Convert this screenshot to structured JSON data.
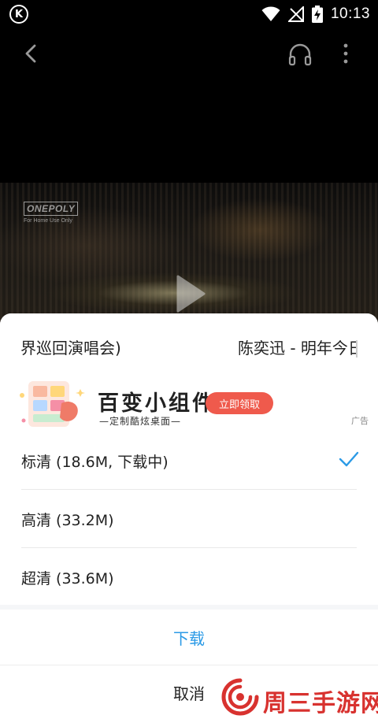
{
  "status_bar": {
    "app_icon_letter": "K",
    "time": "10:13",
    "icons": [
      "wifi-icon",
      "no-signal-icon",
      "battery-charging-icon"
    ]
  },
  "player": {
    "watermark_brand": "ONEPOLY",
    "watermark_note": "For Home Use Only",
    "controls": [
      "back-icon",
      "headphone-icon",
      "more-icon",
      "play-icon"
    ]
  },
  "sheet": {
    "title_left": "界巡回演唱会)",
    "title_right": "陈奕迅 - 明年今日",
    "ad": {
      "title": "百变小组件",
      "subtitle": "—定制酷炫桌面—",
      "button": "立即领取",
      "label": "广告",
      "button_color": "#ef5a4c"
    },
    "options": [
      {
        "label": "标清 (18.6M, 下载中)",
        "selected": true
      },
      {
        "label": "高清 (33.2M)",
        "selected": false
      },
      {
        "label": "超清 (33.6M)",
        "selected": false
      }
    ],
    "download_label": "下载",
    "cancel_label": "取消",
    "accent_color": "#2b9ae6"
  },
  "site_watermark": {
    "name": "周三手游网",
    "color": "#d8322f"
  }
}
